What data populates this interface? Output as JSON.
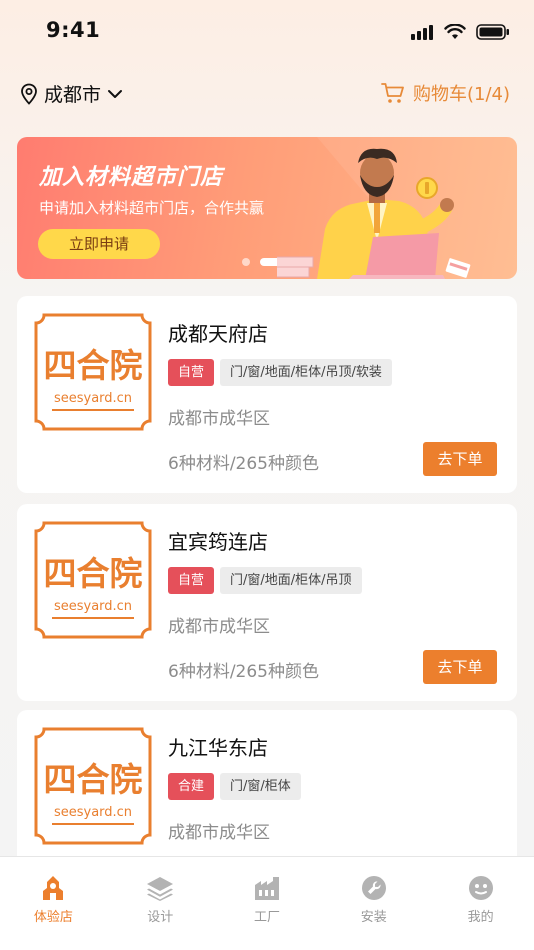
{
  "status": {
    "time": "9:41"
  },
  "header": {
    "city": "成都市",
    "cart_label": "购物车(1/4)"
  },
  "banner": {
    "title": "加入材料超市门店",
    "subtitle": "申请加入材料超市门店，合作共赢",
    "button": "立即申请",
    "slide_count": 2,
    "active_slide": 2
  },
  "logo": {
    "line1": "四合院",
    "line2": "seesyard.cn"
  },
  "stores": [
    {
      "name": "成都天府店",
      "type_tag": "自营",
      "category": "门/窗/地面/柜体/吊顶/软装",
      "address": "成都市成华区",
      "stats": "6种材料/265种颜色",
      "button": "去下单"
    },
    {
      "name": "宜宾筠连店",
      "type_tag": "自营",
      "category": "门/窗/地面/柜体/吊顶",
      "address": "成都市成华区",
      "stats": "6种材料/265种颜色",
      "button": "去下单"
    },
    {
      "name": "九江华东店",
      "type_tag": "合建",
      "category": "门/窗/柜体",
      "address": "成都市成华区",
      "stats": "",
      "button": ""
    }
  ],
  "tabs": [
    {
      "label": "体验店",
      "icon": "store-icon",
      "active": true
    },
    {
      "label": "设计",
      "icon": "layers-icon",
      "active": false
    },
    {
      "label": "工厂",
      "icon": "factory-icon",
      "active": false
    },
    {
      "label": "安装",
      "icon": "wrench-icon",
      "active": false
    },
    {
      "label": "我的",
      "icon": "profile-icon",
      "active": false
    }
  ],
  "colors": {
    "accent": "#ec7f2d",
    "tag_red": "#e5505a",
    "banner_button": "#ffd84a"
  }
}
